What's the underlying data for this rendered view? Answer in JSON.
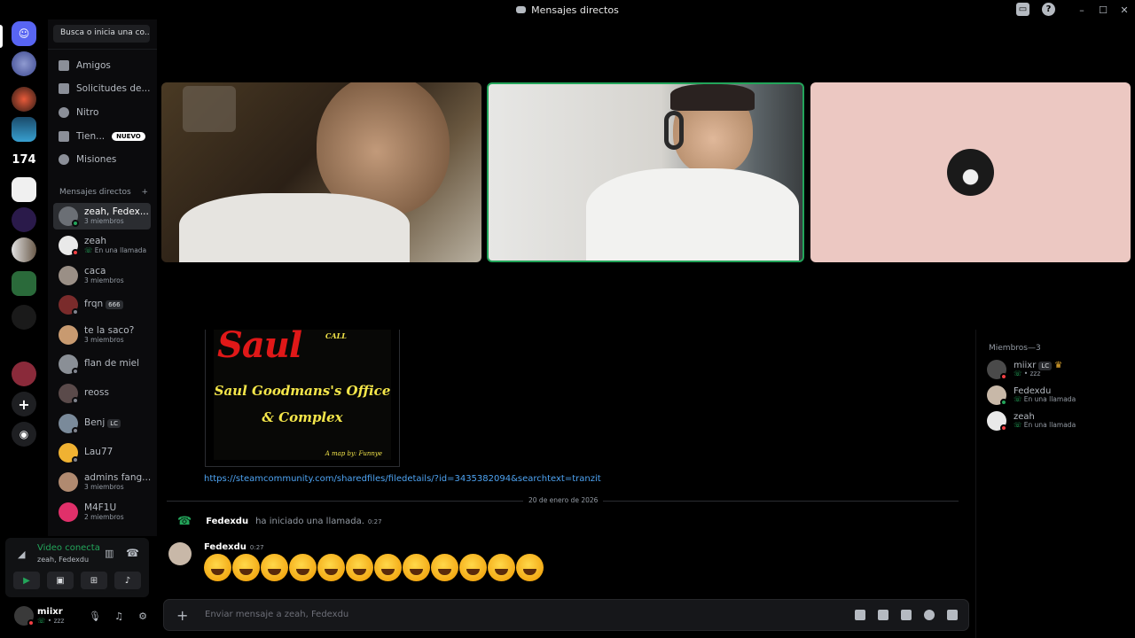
{
  "window": {
    "title": "Mensajes directos"
  },
  "sidebar": {
    "search_placeholder": "Busca o inicia una co...",
    "nav": [
      {
        "label": "Amigos",
        "icon": "friends-icon"
      },
      {
        "label": "Solicitudes de...",
        "icon": "message-requests-icon"
      },
      {
        "label": "Nitro",
        "icon": "nitro-icon"
      },
      {
        "label": "Tien...",
        "icon": "shop-icon",
        "badge": "NUEVO"
      },
      {
        "label": "Misiones",
        "icon": "quests-icon"
      }
    ],
    "dm_header": "Mensajes directos",
    "dm_add": "+",
    "dms": [
      {
        "name": "zeah, Fedex...",
        "sub": "3 miembros",
        "active": true,
        "color": "#6b6f75"
      },
      {
        "name": "zeah",
        "sub": "En una llamada",
        "color": "#e9e9e9"
      },
      {
        "name": "caca",
        "sub": "3 miembros",
        "color": "#9a8f86"
      },
      {
        "name": "frqn",
        "tag": "666",
        "color": "#7a2b2b"
      },
      {
        "name": "te la saco?",
        "sub": "3 miembros",
        "color": "#c89a70"
      },
      {
        "name": "flan de miel",
        "color": "#8a8f96"
      },
      {
        "name": "reoss",
        "color": "#5a4a4a"
      },
      {
        "name": "Benj",
        "tag": "LC",
        "color": "#7a8a9a"
      },
      {
        "name": "Lau77",
        "color": "#f0b232"
      },
      {
        "name": "admins fang...",
        "sub": "3 miembros",
        "color": "#b08a70"
      },
      {
        "name": "M4F1U",
        "sub": "2 miembros",
        "color": "#e0306a"
      }
    ]
  },
  "voice": {
    "status": "Video conecta",
    "channel": "zeah, Fedexdu",
    "buttons": [
      "camera-button",
      "screen-share-button",
      "activities-button",
      "soundboard-button"
    ]
  },
  "user": {
    "name": "miixr",
    "status": "• zzz"
  },
  "chat": {
    "poster": {
      "call_text": "CALL",
      "title": "Saul",
      "line1": "Saul Goodmans's Office",
      "line2": "& Complex",
      "credit": "A map by: Funnye"
    },
    "link": "https://steamcommunity.com/sharedfiles/filedetails/?id=3435382094&searchtext=tranzit",
    "date_divider": "20 de enero de 2026",
    "call_event": {
      "user": "Fedexdu",
      "text": "ha iniciado una llamada.",
      "time": "0:27"
    },
    "message": {
      "author": "Fedexdu",
      "time": "0:27",
      "emoji_count": 12,
      "emoji_name": "rolling-on-floor-laughing"
    },
    "composer_placeholder": "Enviar mensaje a zeah, Fedexdu"
  },
  "members": {
    "header": "Miembros—3",
    "list": [
      {
        "name": "miixr",
        "tag": "LC",
        "sub": "• zzz",
        "crown": true,
        "color": "#4a4a4a",
        "status": "#f23f43"
      },
      {
        "name": "Fedexdu",
        "sub": "En una llamada",
        "color": "#c8b8a8",
        "status": "#23a55a"
      },
      {
        "name": "zeah",
        "sub": "En una llamada",
        "color": "#e9e9e9",
        "status": "#f23f43"
      }
    ]
  },
  "colors": {
    "accent_green": "#23a55a",
    "link_blue": "#4ea4f3",
    "dnd_red": "#f23f43"
  }
}
